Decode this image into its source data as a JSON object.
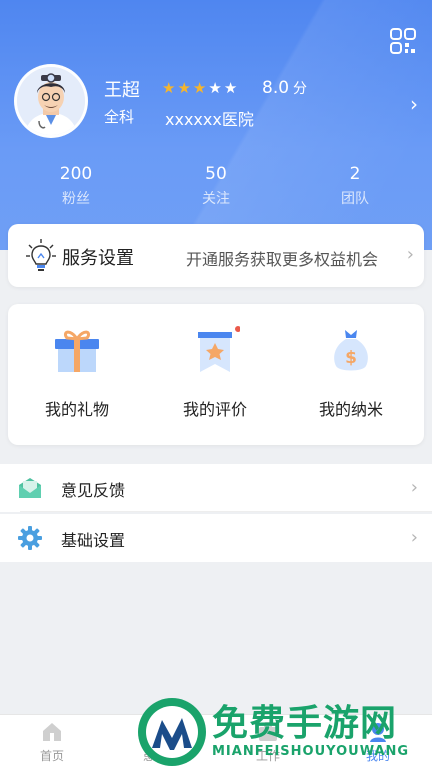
{
  "header": {
    "qr_icon": "qr-code-icon",
    "name": "王超",
    "rating_stars": {
      "filled": 3,
      "total": 5
    },
    "rating": "8.0",
    "rating_unit": "分",
    "department": "全科",
    "hospital": "xxxxxx医院",
    "stats": [
      {
        "value": "200",
        "label": "粉丝"
      },
      {
        "value": "50",
        "label": "关注"
      },
      {
        "value": "2",
        "label": "团队"
      }
    ],
    "colors": {
      "gradient_top": "#4f86f0",
      "gradient_bottom": "#6f9ff5",
      "star": "#f5b52e"
    }
  },
  "service": {
    "icon": "lightbulb-icon",
    "title": "服务设置",
    "description": "开通服务获取更多权益机会"
  },
  "shortcuts": [
    {
      "icon": "gift-icon",
      "label": "我的礼物",
      "badge": false
    },
    {
      "icon": "review-ribbon-icon",
      "label": "我的评价",
      "badge": true
    },
    {
      "icon": "money-bag-icon",
      "label": "我的纳米",
      "badge": false
    }
  ],
  "menu": [
    {
      "icon": "envelope-icon",
      "label": "意见反馈"
    },
    {
      "icon": "gear-icon",
      "label": "基础设置"
    }
  ],
  "tabbar": {
    "tabs": [
      {
        "icon": "home-icon",
        "label": "首页"
      },
      {
        "icon": "patients-icon",
        "label": "患者"
      },
      {
        "icon": "work-icon",
        "label": "工作"
      },
      {
        "icon": "me-icon",
        "label": "我的"
      }
    ],
    "active_index": 3
  },
  "watermark": {
    "text": "免费手游网",
    "subtext": "MIANFEISHOUYOUWANG"
  }
}
